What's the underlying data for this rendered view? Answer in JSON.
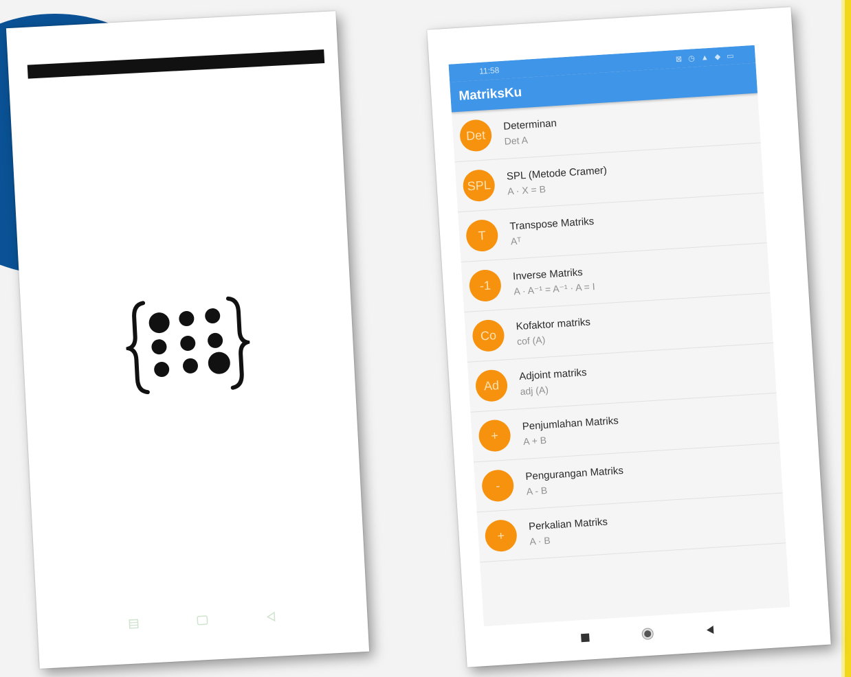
{
  "app": {
    "title": "MatriksKu",
    "status_time": "11:58",
    "status_icons": "⊠ ◷ ▲ ◆ ▭"
  },
  "menu": {
    "items": [
      {
        "icon_label": "Det",
        "title": "Determinan",
        "subtitle": "Det A"
      },
      {
        "icon_label": "SPL",
        "title": "SPL (Metode Cramer)",
        "subtitle": "A · X = B"
      },
      {
        "icon_label": "T",
        "title": "Transpose Matriks",
        "subtitle": "Aᵀ"
      },
      {
        "icon_label": "-1",
        "title": "Inverse Matriks",
        "subtitle": "A · A⁻¹ = A⁻¹ · A = I"
      },
      {
        "icon_label": "Co",
        "title": "Kofaktor matriks",
        "subtitle": "cof (A)"
      },
      {
        "icon_label": "Ad",
        "title": "Adjoint matriks",
        "subtitle": "adj (A)"
      },
      {
        "icon_label": "+",
        "title": "Penjumlahan Matriks",
        "subtitle": "A + B"
      },
      {
        "icon_label": "-",
        "title": "Pengurangan Matriks",
        "subtitle": "A - B"
      },
      {
        "icon_label": "+",
        "title": "Perkalian Matriks",
        "subtitle": "A · B"
      }
    ]
  },
  "colors": {
    "app_bar": "#3f95e8",
    "avatar": "#f7920e",
    "background_circle": "#0a5295",
    "accent_edge": "#f2d71a"
  },
  "icons": {
    "splash_logo": "matrix-braces-icon",
    "nav_recent": "recent-apps-icon",
    "nav_home": "home-icon",
    "nav_back": "back-icon"
  }
}
